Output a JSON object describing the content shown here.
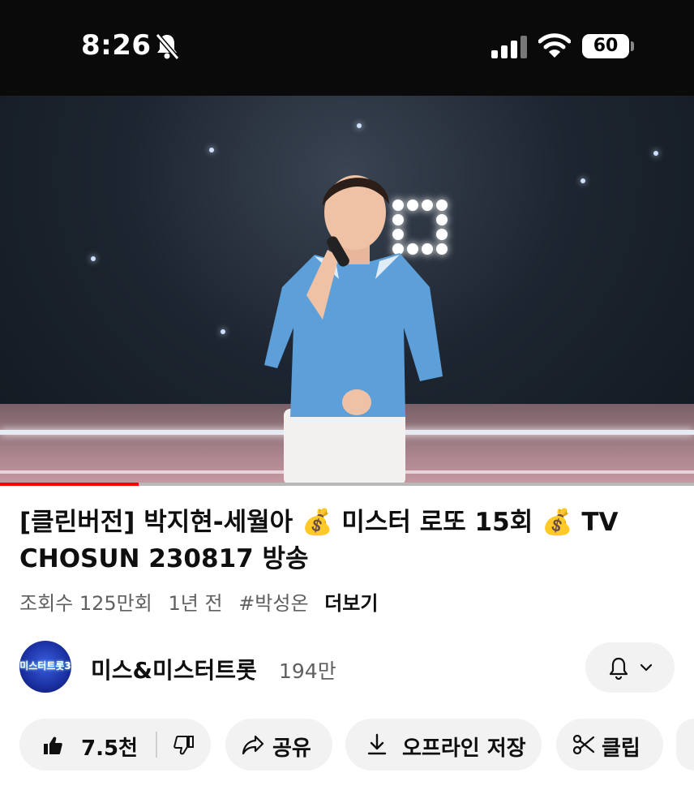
{
  "status_bar": {
    "time": "8:26",
    "battery": "60"
  },
  "video": {
    "progress": 0.2
  },
  "title": "[클린버전] 박지현-세월아 💰 미스터 로또 15회 💰 TV CHOSUN 230817 방송",
  "meta": {
    "views": "조회수 125만회",
    "age": "1년 전",
    "hashtag": "#박성온",
    "more": "더보기"
  },
  "channel": {
    "avatar_text": "미스터트롯3",
    "name": "미스&미스터트롯",
    "subscribers": "194만"
  },
  "actions": {
    "likes": "7.5천",
    "share": "공유",
    "download": "오프라인 저장",
    "clip": "클립"
  },
  "colors": {
    "progress": "#ff0000",
    "pill_bg": "#f2f2f2"
  }
}
